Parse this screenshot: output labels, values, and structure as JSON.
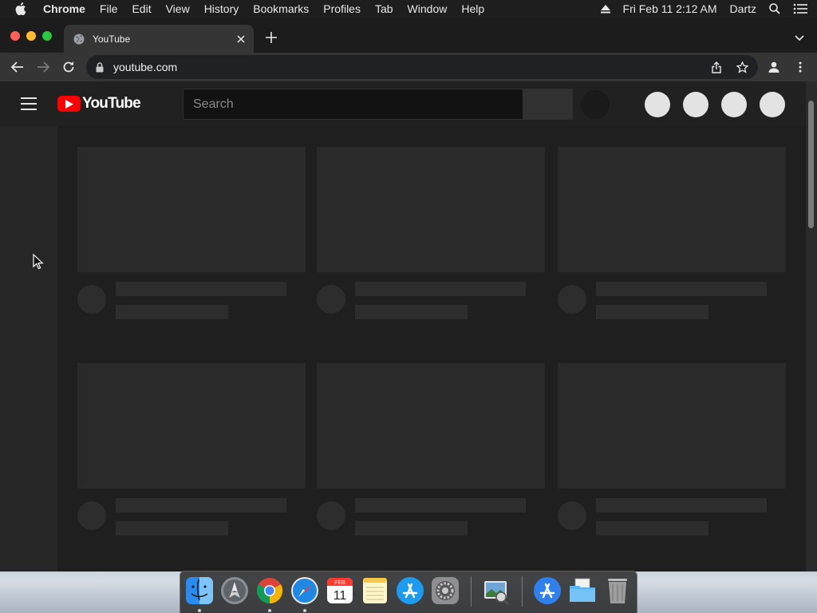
{
  "menubar": {
    "app_name": "Chrome",
    "menus": [
      "File",
      "Edit",
      "View",
      "History",
      "Bookmarks",
      "Profiles",
      "Tab",
      "Window",
      "Help"
    ],
    "datetime": "Fri Feb 11  2:12 AM",
    "user": "Dartz"
  },
  "browser": {
    "tab_title": "YouTube",
    "url": "youtube.com"
  },
  "youtube": {
    "logo_text": "YouTube",
    "search_placeholder": "Search"
  },
  "dock": {
    "apps": [
      "finder",
      "launchpad",
      "chrome",
      "safari",
      "calendar",
      "notes",
      "app-store",
      "system-preferences",
      "preview",
      "applications-folder",
      "documents-folder",
      "trash"
    ],
    "calendar_month": "FEB",
    "calendar_day": "11"
  },
  "colors": {
    "youtube_red": "#ff0000",
    "page_background": "#1f1f1f",
    "placeholder_block": "#2a2a2a"
  }
}
